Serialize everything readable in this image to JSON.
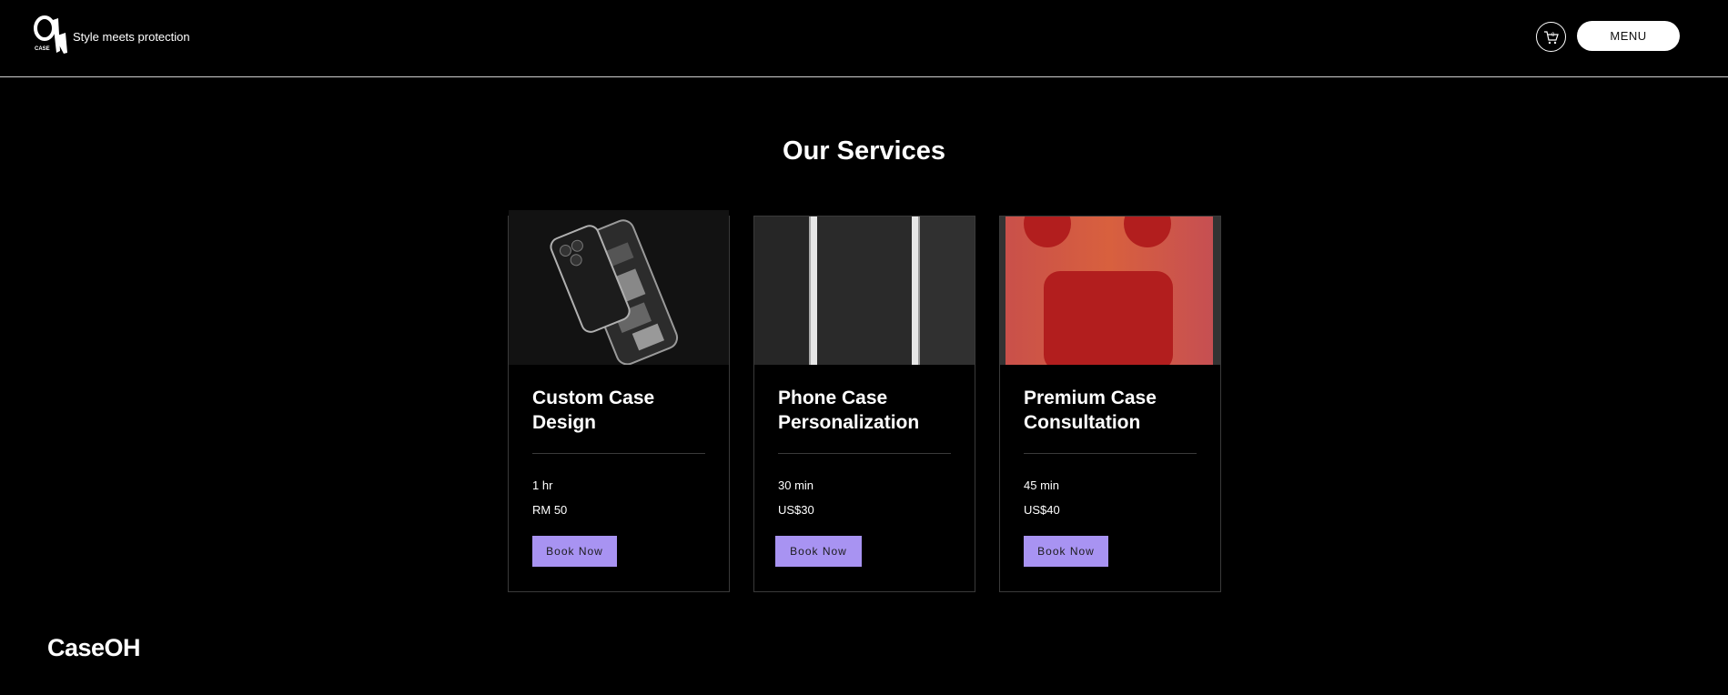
{
  "header": {
    "tagline": "Style meets protection",
    "menu_label": "MENU",
    "cart_count": "0"
  },
  "main": {
    "title": "Our Services",
    "services": [
      {
        "title": "Custom Case Design",
        "duration": "1 hr",
        "price": "RM 50",
        "button": "Book Now"
      },
      {
        "title": "Phone Case Personalization",
        "duration": "30 min",
        "price": "US$30",
        "button": "Book Now"
      },
      {
        "title": "Premium Case Consultation",
        "duration": "45 min",
        "price": "US$40",
        "button": "Book Now"
      }
    ]
  },
  "footer": {
    "brand": "CaseOH"
  },
  "colors": {
    "background": "#000000",
    "accent_button": "#a893f2"
  }
}
